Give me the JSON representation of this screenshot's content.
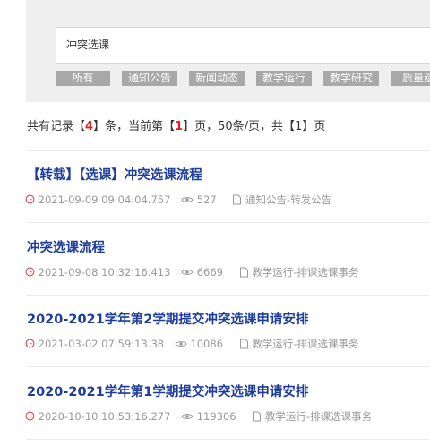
{
  "search": {
    "query": "冲突选课"
  },
  "categories": [
    "所有",
    "通知公告",
    "新闻动态",
    "教学运行",
    "教学研究",
    "质量建"
  ],
  "summary": {
    "prefix": "共有记录【",
    "total": "4",
    "mid1": "】条，当前第【",
    "current_page": "1",
    "mid2": "】页，50条/页，共【",
    "total_pages": "1",
    "suffix": "】页"
  },
  "results": [
    {
      "title": "【转载】【选课】冲突选课流程",
      "date": "2021-09-09 09:04:04.757",
      "views": "527",
      "category": "通知公告-转发公告"
    },
    {
      "title": "冲突选课流程",
      "date": "2021-09-08 10:32:16.413",
      "views": "6669",
      "category": "教学运行-排课选课事务"
    },
    {
      "title": "2020-2021学年第2学期提交冲突选课申请安排",
      "date": "2021-03-02 07:59:13.38",
      "views": "10086",
      "category": "教学运行-排课选课事务"
    },
    {
      "title": "2020-2021学年第1学期提交冲突选课申请安排",
      "date": "2020-10-10 10:53:16.277",
      "views": "119306",
      "category": "教学运行-排课选课事务"
    }
  ]
}
